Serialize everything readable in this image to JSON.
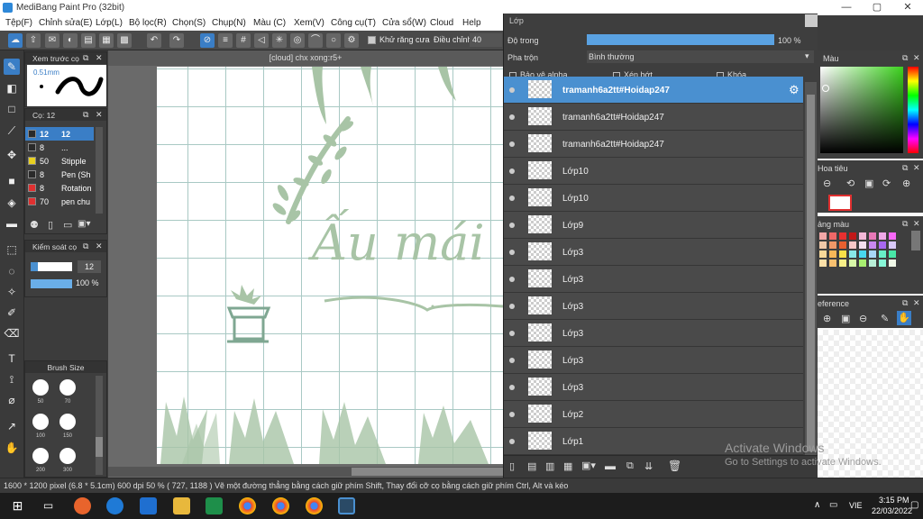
{
  "window": {
    "title": "MediBang Paint Pro (32bit)"
  },
  "menu": [
    "Tệp(F)",
    "Chỉnh sửa(E)",
    "Lớp(L)",
    "Bộ lọc(R)",
    "Chọn(S)",
    "Chụp(N)",
    "Màu (C)",
    "Xem(V)",
    "Công cụ(T)",
    "Cửa sổ(W)",
    "Cloud",
    "Help"
  ],
  "toolbar": {
    "antialias_label": "Khử răng cưa",
    "adjust_label": "Điều chỉnh",
    "adjust_value": "40"
  },
  "document": {
    "tab_title": "[cloud] chx xong:r5+",
    "artwork_text": "Ấu mái"
  },
  "brush_preview": {
    "title": "Xem trước cọ",
    "size": "0.51mm"
  },
  "brush_list": {
    "title": "Cọ: 12",
    "items": [
      {
        "size": "12",
        "name": "12",
        "color": "#2a2a2a"
      },
      {
        "size": "8",
        "name": "...",
        "color": "#2a2a2a"
      },
      {
        "size": "50",
        "name": "Stipple",
        "color": "#e8d020"
      },
      {
        "size": "8",
        "name": "Pen (Sh",
        "color": "#2a2a2a"
      },
      {
        "size": "8",
        "name": "Rotation",
        "color": "#e03030"
      },
      {
        "size": "70",
        "name": "pen chu",
        "color": "#e03030"
      }
    ]
  },
  "brush_control": {
    "title": "Kiểm soát cọ",
    "size": "12",
    "opacity": "100 %",
    "opacity_fill": 1.0
  },
  "brush_size": {
    "title": "Brush Size",
    "sizes": [
      "50",
      "70",
      "100",
      "150",
      "200",
      "300"
    ]
  },
  "layer_panel": {
    "title": "Lớp",
    "opacity_label": "Độ trong",
    "opacity_value": "100 %",
    "opacity_fill": 1.0,
    "blend_label": "Pha trộn",
    "blend_value": "Bình thường",
    "protect_alpha": "Bảo vệ alpha",
    "clipping": "Xén bớt",
    "lock": "Khóa",
    "layers": [
      {
        "name": "tramanh6a2tt#Hoidap247",
        "selected": true
      },
      {
        "name": "tramanh6a2tt#Hoidap247",
        "selected": false
      },
      {
        "name": "tramanh6a2tt#Hoidap247",
        "selected": false
      },
      {
        "name": "Lớp10",
        "selected": false
      },
      {
        "name": "Lớp10",
        "selected": false
      },
      {
        "name": "Lớp9",
        "selected": false
      },
      {
        "name": "Lớp3",
        "selected": false
      },
      {
        "name": "Lớp3",
        "selected": false
      },
      {
        "name": "Lớp3",
        "selected": false
      },
      {
        "name": "Lớp3",
        "selected": false
      },
      {
        "name": "Lớp3",
        "selected": false
      },
      {
        "name": "Lớp3",
        "selected": false
      },
      {
        "name": "Lớp2",
        "selected": false
      },
      {
        "name": "Lớp1",
        "selected": false
      }
    ]
  },
  "right_panels": {
    "color": "Màu",
    "navigator": "Hoa tiêu",
    "palette": "ảng màu",
    "reference": "eference"
  },
  "status": {
    "text": "1600 * 1200 pixel   (6.8 * 5.1cm)   600 dpi   50 %   ( 727, 1188 )   Vẽ một đường thẳng bằng cách giữ phím Shift, Thay đổi cỡ cọ bằng cách giữ phím Ctrl, Alt và kéo"
  },
  "watermark": {
    "line1": "Activate Windows",
    "line2": "Go to Settings to activate Windows."
  },
  "taskbar": {
    "time": "3:15 PM",
    "date": "22/03/2022",
    "lang": "VIE"
  },
  "colors": {
    "accent": "#4a90d0",
    "plant": "#a8c4a6",
    "plant_dark": "#7fa792"
  }
}
